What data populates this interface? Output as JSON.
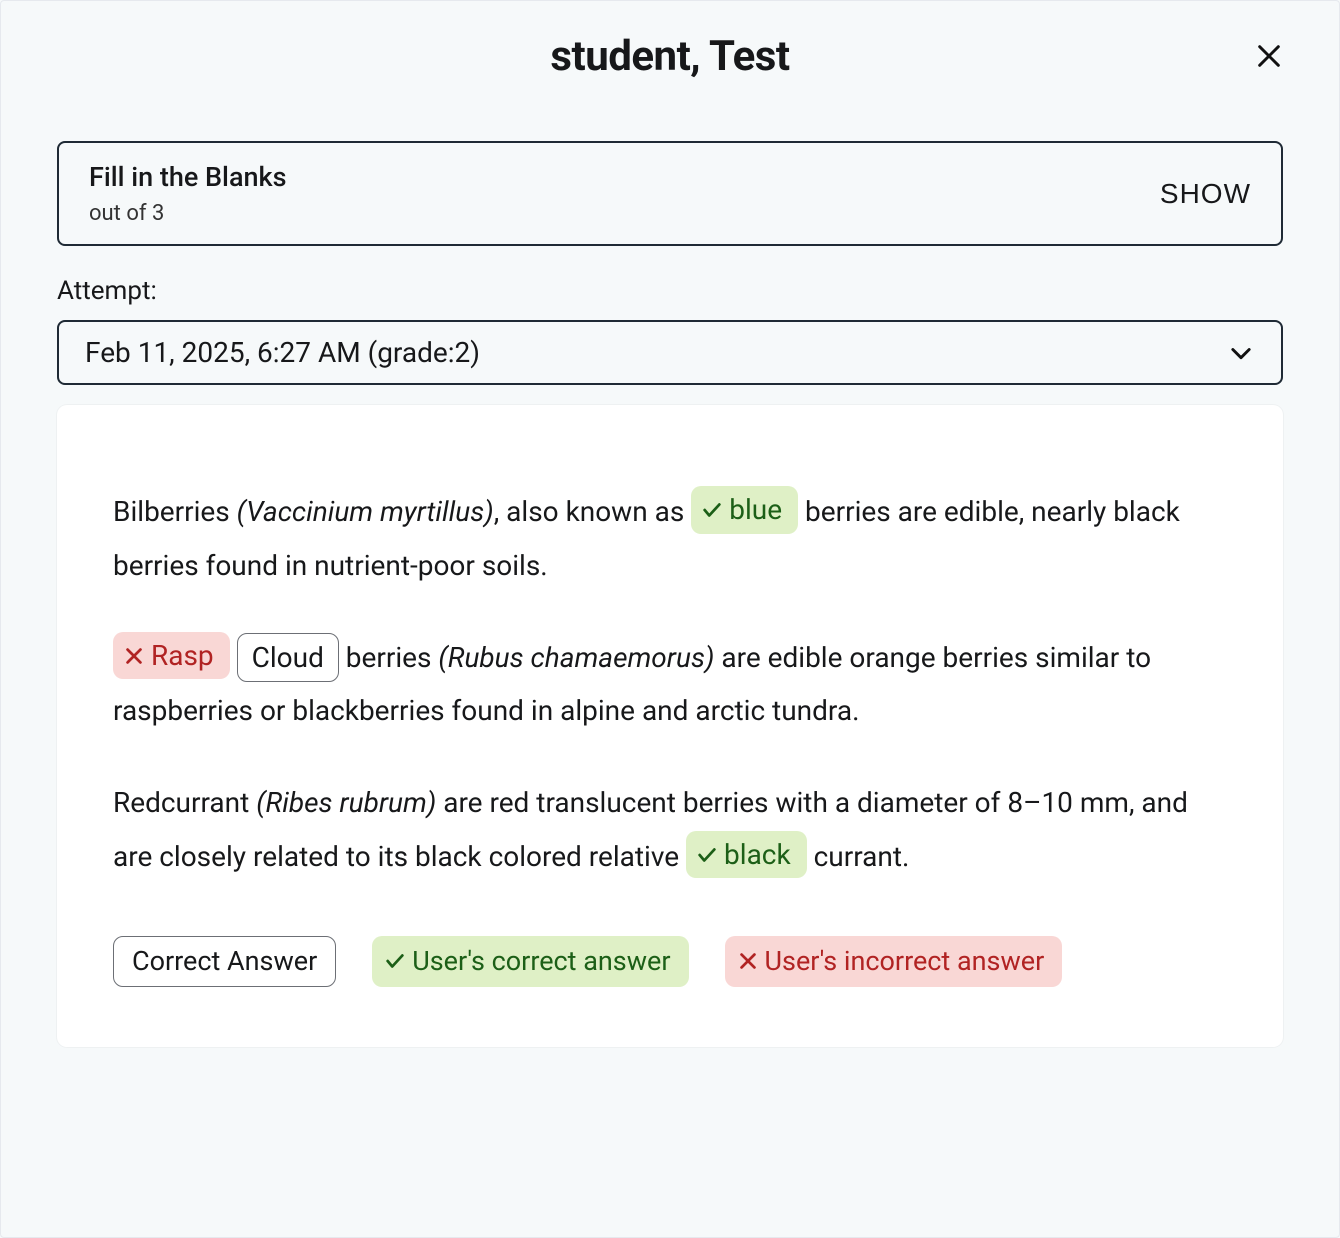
{
  "header": {
    "title": "student, Test"
  },
  "question_bar": {
    "title": "Fill in the Blanks",
    "sub": "out of 3",
    "show_label": "SHOW"
  },
  "attempt": {
    "label": "Attempt:",
    "selected": "Feb 11, 2025, 6:27 AM (grade:2)"
  },
  "passage": {
    "p1": {
      "a": "Bilberries ",
      "i": "(Vaccinium myrtillus)",
      "b": ", also known as ",
      "blank": "blue",
      "blank_status": "correct",
      "c": " berries are edible, nearly black berries found in nutrient-poor soils."
    },
    "p2": {
      "blank_user": "Rasp",
      "blank_user_status": "incorrect",
      "blank_correct": "Cloud",
      "a": " berries ",
      "i": "(Rubus chamaemorus)",
      "b": " are edible orange berries similar to raspberries or blackberries found in alpine and arctic tundra."
    },
    "p3": {
      "a": "Redcurrant ",
      "i": "(Ribes rubrum)",
      "b": " are red translucent berries with a diameter of 8–10 mm, and are closely related to its black colored relative ",
      "blank": "black",
      "blank_status": "correct",
      "c": " currant."
    }
  },
  "legend": {
    "correct_answer": "Correct Answer",
    "user_correct": "User's correct answer",
    "user_incorrect": "User's incorrect answer"
  }
}
